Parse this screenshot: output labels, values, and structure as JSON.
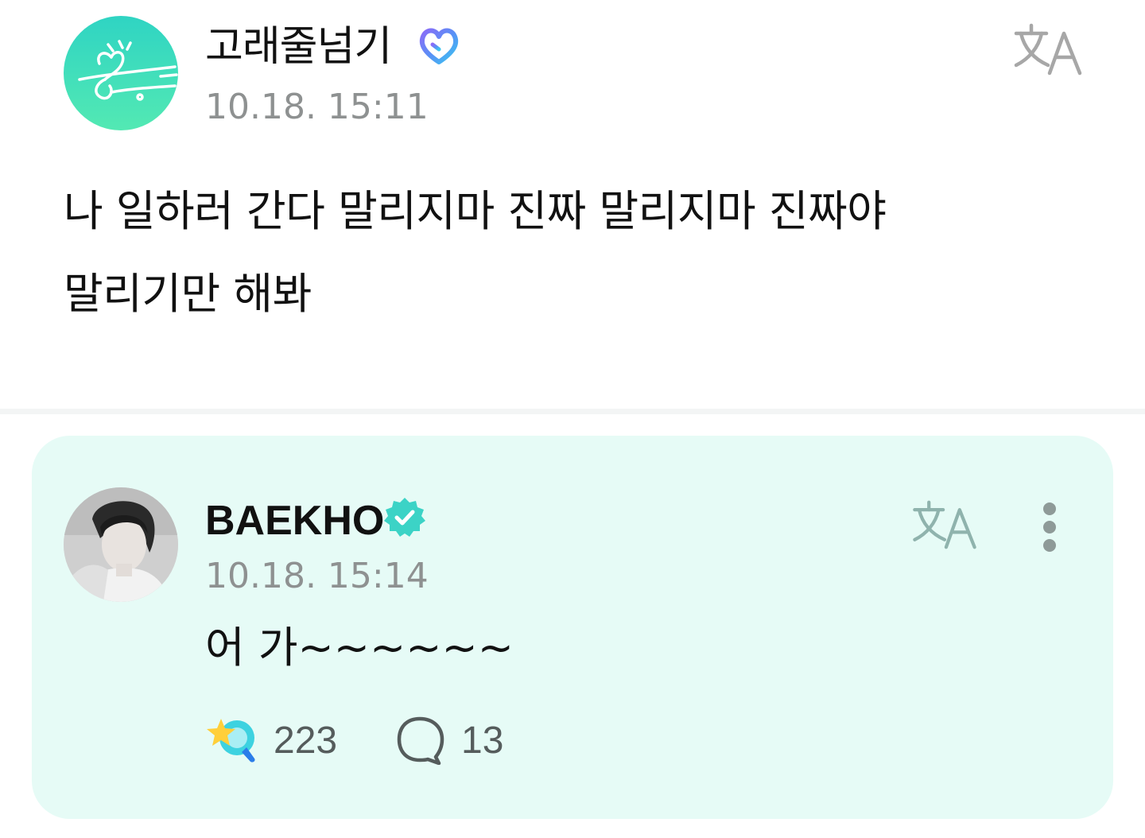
{
  "post": {
    "author": "고래줄넘기",
    "timestamp": "10.18. 15:11",
    "body_lines": [
      "나 일하러 간다 말리지마 진짜 말리지마 진짜야",
      "말리기만 해봐"
    ],
    "avatar_icon": "heart-doodle-logo",
    "badge_icon": "official-heart-badge"
  },
  "comment": {
    "author": "BAEKHO",
    "timestamp": "10.18. 15:14",
    "body": "어 가~~~~~~",
    "reactions": {
      "count": "223",
      "icon": "star-reaction-icon"
    },
    "replies": {
      "count": "13",
      "icon": "speech-bubble-icon"
    },
    "badge_icon": "verified-check-badge"
  },
  "colors": {
    "card_background": "#e6fbf6",
    "accent": "#30d5c8",
    "timestamp": "#8e9191",
    "divider": "#f3f5f5"
  }
}
